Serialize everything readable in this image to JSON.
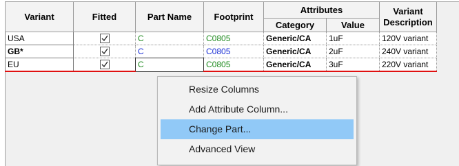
{
  "table": {
    "headers": {
      "variant": "Variant",
      "fitted": "Fitted",
      "part_name": "Part Name",
      "footprint": "Footprint",
      "attributes": "Attributes",
      "category": "Category",
      "value": "Value",
      "variant_desc_line1": "Variant",
      "variant_desc_line2": "Description"
    },
    "rows": [
      {
        "variant": "USA",
        "fitted": true,
        "part": "C",
        "footprint": "C0805",
        "category": "Generic/CA",
        "value": "1uF",
        "description": "120V variant"
      },
      {
        "variant": "GB*",
        "fitted": true,
        "part": "C",
        "footprint": "C0805",
        "category": "Generic/CA",
        "value": "2uF",
        "description": "240V variant"
      },
      {
        "variant": "EU",
        "fitted": true,
        "part": "C",
        "footprint": "C0805",
        "category": "Generic/CA",
        "value": "3uF",
        "description": "220V variant"
      }
    ]
  },
  "context_menu": {
    "items": [
      {
        "label": "Resize Columns"
      },
      {
        "label": "Add Attribute Column..."
      },
      {
        "label": "Change Part..."
      },
      {
        "label": "Advanced View"
      }
    ],
    "highlighted": "Change Part..."
  },
  "colors": {
    "menu_highlight": "#91c9f7",
    "current_row_line": "#e01010",
    "part_green": "#1f8a1f",
    "part_blue": "#1a2fd6"
  }
}
